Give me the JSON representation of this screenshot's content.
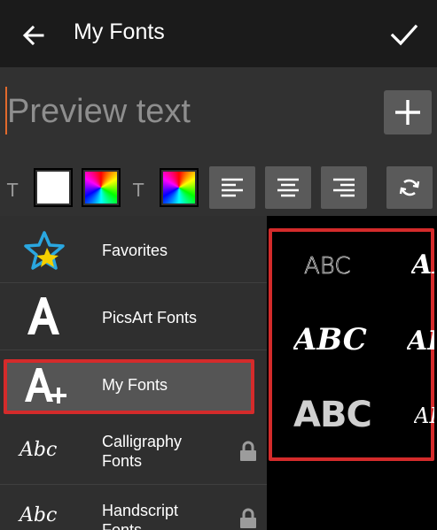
{
  "header": {
    "title": "My Fonts"
  },
  "preview": {
    "placeholder": "Preview text",
    "value": ""
  },
  "tools": {
    "text_label_1": "T",
    "text_label_2": "T"
  },
  "font_categories": [
    {
      "label": "Favorites",
      "icon": "star-icon",
      "locked": false,
      "selected": false
    },
    {
      "label": "PicsArt Fonts",
      "icon": "letter-a-icon",
      "locked": false,
      "selected": false
    },
    {
      "label": "My Fonts",
      "icon": "letter-a-plus-icon",
      "locked": false,
      "selected": true
    },
    {
      "label": "Calligraphy Fonts",
      "label_line1": "Calligraphy",
      "label_line2": "Fonts",
      "icon_text": "Abc",
      "locked": true,
      "selected": false
    },
    {
      "label": "Handscript Fonts",
      "label_line1": "Handscript",
      "label_line2": "Fonts",
      "icon_text": "Abc",
      "locked": true,
      "selected": false
    }
  ],
  "font_samples": [
    {
      "text": "ABC"
    },
    {
      "text": "AB"
    },
    {
      "text": "ABC"
    },
    {
      "text": "AB"
    },
    {
      "text": "ABC"
    },
    {
      "text": "AB"
    }
  ],
  "colors": {
    "accent_red": "#d42b2b",
    "caret": "#e26a2c",
    "bar": "#1b1b1b"
  }
}
